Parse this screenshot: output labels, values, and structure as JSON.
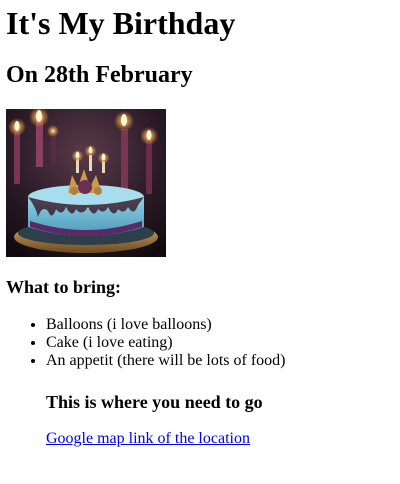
{
  "page": {
    "title": "It's My Birthday",
    "subtitle": "On 28th February"
  },
  "image": {
    "icon": "birthday-cake-photo"
  },
  "bring": {
    "heading": "What to bring:",
    "items": [
      "Balloons (i love balloons)",
      "Cake (i love eating)",
      "An appetit (there will be lots of food)"
    ]
  },
  "location": {
    "heading": "This is where you need to go",
    "link_text": "Google map link of the location"
  },
  "colors": {
    "link": "#0000ee",
    "text": "#000000",
    "background": "#ffffff"
  }
}
